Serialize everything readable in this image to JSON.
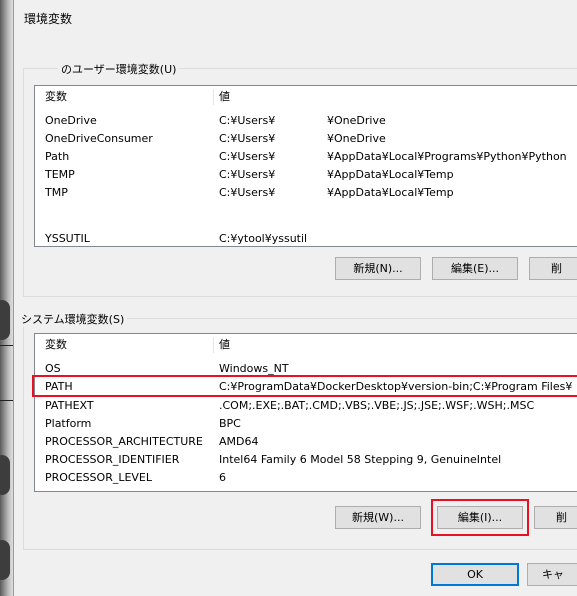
{
  "dialog": {
    "title": "環境変数"
  },
  "user_vars": {
    "group_label": "のユーザー環境変数(U)",
    "headers": {
      "name": "変数",
      "value": "値"
    },
    "rows": [
      {
        "name": "OneDrive",
        "v1": "C:¥Users¥",
        "v2": "¥OneDrive"
      },
      {
        "name": "OneDriveConsumer",
        "v1": "C:¥Users¥",
        "v2": "¥OneDrive"
      },
      {
        "name": "Path",
        "v1": "C:¥Users¥",
        "v2": "¥AppData¥Local¥Programs¥Python¥Python"
      },
      {
        "name": "TEMP",
        "v1": "C:¥Users¥",
        "v2": "¥AppData¥Local¥Temp"
      },
      {
        "name": "TMP",
        "v1": "C:¥Users¥",
        "v2": "¥AppData¥Local¥Temp"
      },
      {
        "name": "YSSUTIL",
        "v1": "C:¥ytool¥yssutil",
        "v2": ""
      }
    ],
    "buttons": {
      "new": "新規(N)...",
      "edit": "編集(E)...",
      "delete": "削"
    }
  },
  "system_vars": {
    "group_label": "システム環境変数(S)",
    "headers": {
      "name": "変数",
      "value": "値"
    },
    "rows": [
      {
        "name": "OS",
        "value": "Windows_NT"
      },
      {
        "name": "PATH",
        "value": "C:¥ProgramData¥DockerDesktop¥version-bin;C:¥Program Files¥"
      },
      {
        "name": "PATHEXT",
        "value": ".COM;.EXE;.BAT;.CMD;.VBS;.VBE;.JS;.JSE;.WSF;.WSH;.MSC"
      },
      {
        "name": "Platform",
        "value": "BPC"
      },
      {
        "name": "PROCESSOR_ARCHITECTURE",
        "value": "AMD64"
      },
      {
        "name": "PROCESSOR_IDENTIFIER",
        "value": "Intel64 Family 6 Model 58 Stepping 9, GenuineIntel"
      },
      {
        "name": "PROCESSOR_LEVEL",
        "value": "6"
      }
    ],
    "buttons": {
      "new": "新規(W)...",
      "edit": "編集(I)...",
      "delete": "削"
    }
  },
  "footer": {
    "ok": "OK",
    "cancel": "キャ"
  },
  "highlight_color": "#e81123"
}
